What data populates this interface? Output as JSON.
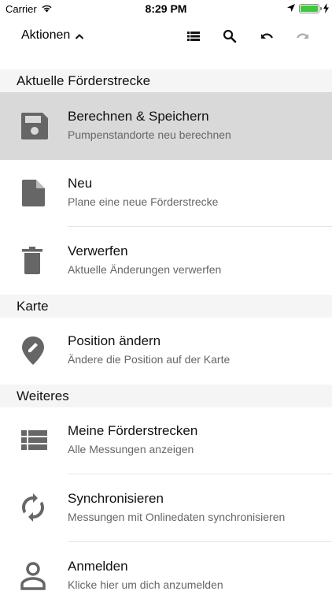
{
  "status_bar": {
    "carrier": "Carrier",
    "time": "8:29 PM",
    "battery_level": 1.0
  },
  "toolbar": {
    "actions_label": "Aktionen",
    "icons": [
      "list-icon",
      "search-icon",
      "undo-icon",
      "redo-icon"
    ]
  },
  "sections": {
    "current": {
      "header": "Aktuelle Förderstrecke",
      "items": [
        {
          "title": "Berechnen & Speichern",
          "subtitle": "Pumpenstandorte neu berechnen",
          "icon": "save-icon"
        },
        {
          "title": "Neu",
          "subtitle": "Plane eine neue Förderstrecke",
          "icon": "document-icon"
        },
        {
          "title": "Verwerfen",
          "subtitle": "Aktuelle Änderungen verwerfen",
          "icon": "trash-icon"
        }
      ]
    },
    "map": {
      "header": "Karte",
      "items": [
        {
          "title": "Position ändern",
          "subtitle": "Ändere die Position auf der Karte",
          "icon": "map-pin-edit-icon"
        }
      ]
    },
    "more": {
      "header": "Weiteres",
      "items": [
        {
          "title": "Meine Förderstrecken",
          "subtitle": "Alle Messungen anzeigen",
          "icon": "list-icon"
        },
        {
          "title": "Synchronisieren",
          "subtitle": "Messungen mit Onlinedaten synchronisieren",
          "icon": "sync-icon"
        },
        {
          "title": "Anmelden",
          "subtitle": "Klicke hier um dich anzumelden",
          "icon": "person-icon"
        }
      ]
    }
  },
  "colors": {
    "icon": "#666666",
    "highlight": "#d9d9d9",
    "section_bg": "#f5f5f5",
    "battery": "#3fc83c"
  }
}
